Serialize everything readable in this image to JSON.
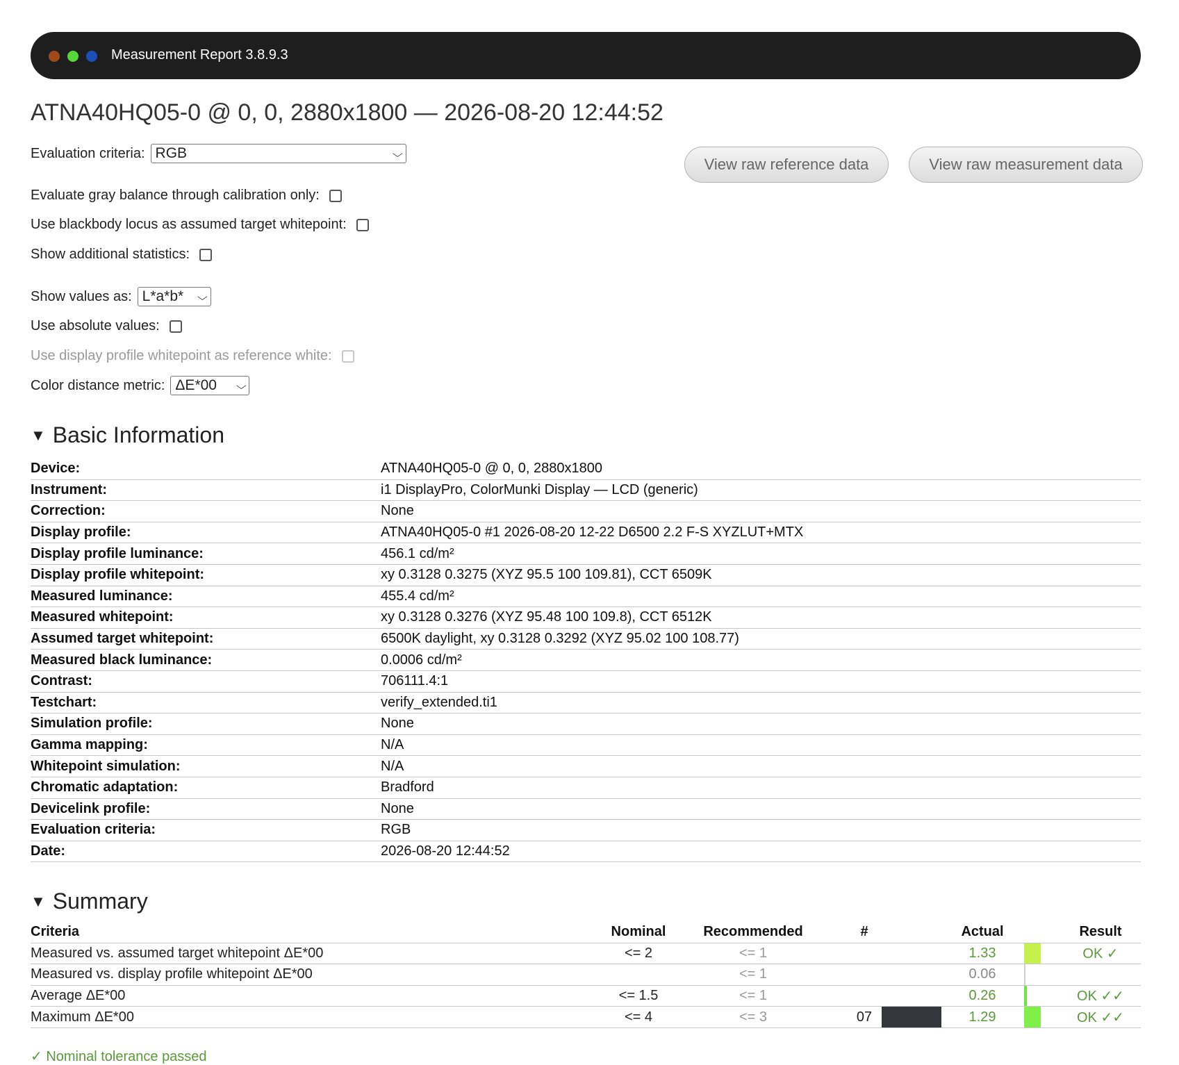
{
  "window": {
    "title": "Measurement Report 3.8.9.3",
    "dot_colors": [
      "#a04a1c",
      "#57d63b",
      "#1c4fb6"
    ]
  },
  "heading": "ATNA40HQ05-0 @ 0, 0, 2880x1800 — 2026-08-20 12:44:52",
  "controls": {
    "evaluation_criteria": {
      "label": "Evaluation criteria:",
      "value": "RGB"
    },
    "gray_balance": {
      "label": "Evaluate gray balance through calibration only:",
      "checked": false
    },
    "blackbody": {
      "label": "Use blackbody locus as assumed target whitepoint:",
      "checked": false
    },
    "additional_stats": {
      "label": "Show additional statistics:",
      "checked": false
    },
    "show_values_as": {
      "label": "Show values as:",
      "value": "L*a*b*"
    },
    "absolute_values": {
      "label": "Use absolute values:",
      "checked": false
    },
    "display_profile_whitepoint": {
      "label": "Use display profile whitepoint as reference white:",
      "checked": false,
      "disabled": true
    },
    "color_distance_metric": {
      "label": "Color distance metric:",
      "value": "ΔE*00"
    }
  },
  "buttons": {
    "raw_reference": "View raw reference data",
    "raw_measurement": "View raw measurement data"
  },
  "basic_info": {
    "title": "Basic Information",
    "rows": [
      {
        "key": "Device:",
        "value": "ATNA40HQ05-0 @ 0, 0, 2880x1800"
      },
      {
        "key": "Instrument:",
        "value": "i1 DisplayPro, ColorMunki Display — LCD (generic)"
      },
      {
        "key": "Correction:",
        "value": "None"
      },
      {
        "key": "Display profile:",
        "value": "ATNA40HQ05-0 #1 2026-08-20 12-22 D6500 2.2 F-S XYZLUT+MTX"
      },
      {
        "key": "Display profile luminance:",
        "value": "456.1 cd/m²"
      },
      {
        "key": "Display profile whitepoint:",
        "value": "xy 0.3128 0.3275 (XYZ 95.5 100 109.81), CCT 6509K"
      },
      {
        "key": "Measured luminance:",
        "value": "455.4 cd/m²"
      },
      {
        "key": "Measured whitepoint:",
        "value": "xy 0.3128 0.3276 (XYZ 95.48 100 109.8), CCT 6512K"
      },
      {
        "key": "Assumed target whitepoint:",
        "value": "6500K daylight, xy 0.3128 0.3292 (XYZ 95.02 100 108.77)"
      },
      {
        "key": "Measured black luminance:",
        "value": "0.0006 cd/m²"
      },
      {
        "key": "Contrast:",
        "value": "706111.4:1"
      },
      {
        "key": "Testchart:",
        "value": "verify_extended.ti1"
      },
      {
        "key": "Simulation profile:",
        "value": "None"
      },
      {
        "key": "Gamma mapping:",
        "value": "N/A"
      },
      {
        "key": "Whitepoint simulation:",
        "value": "N/A"
      },
      {
        "key": "Chromatic adaptation:",
        "value": "Bradford"
      },
      {
        "key": "Devicelink profile:",
        "value": "None"
      },
      {
        "key": "Evaluation criteria:",
        "value": "RGB"
      },
      {
        "key": "Date:",
        "value": "2026-08-20 12:44:52"
      }
    ]
  },
  "summary": {
    "title": "Summary",
    "headers": {
      "criteria": "Criteria",
      "nominal": "Nominal",
      "recommended": "Recommended",
      "num": "#",
      "actual": "Actual",
      "result": "Result"
    },
    "rows": [
      {
        "criteria": "Measured vs. assumed target whitepoint ΔE*00",
        "nominal": "<= 2",
        "recommended": "<= 1",
        "num": "",
        "swatch": "",
        "actual": "1.33",
        "actual_gray": false,
        "bar_color": "#c6f04a",
        "bar_level": 1.0,
        "result": "OK ✓"
      },
      {
        "criteria": "Measured vs. display profile whitepoint ΔE*00",
        "nominal": "",
        "recommended": "<= 1",
        "num": "",
        "swatch": "",
        "actual": "0.06",
        "actual_gray": true,
        "bar_color": "#cfcfcf",
        "bar_level": 0.1,
        "result": ""
      },
      {
        "criteria": "Average ΔE*00",
        "nominal": "<= 1.5",
        "recommended": "<= 1",
        "num": "",
        "swatch": "",
        "actual": "0.26",
        "actual_gray": false,
        "bar_color": "#6fe34a",
        "bar_level": 0.15,
        "result": "OK ✓✓"
      },
      {
        "criteria": "Maximum ΔE*00",
        "nominal": "<= 4",
        "recommended": "<= 3",
        "num": "07",
        "swatch": "#33363c",
        "actual": "1.29",
        "actual_gray": false,
        "bar_color": "#7ff04a",
        "bar_level": 1.0,
        "result": "OK ✓✓"
      }
    ]
  },
  "status_note": "✓ Nominal tolerance passed"
}
